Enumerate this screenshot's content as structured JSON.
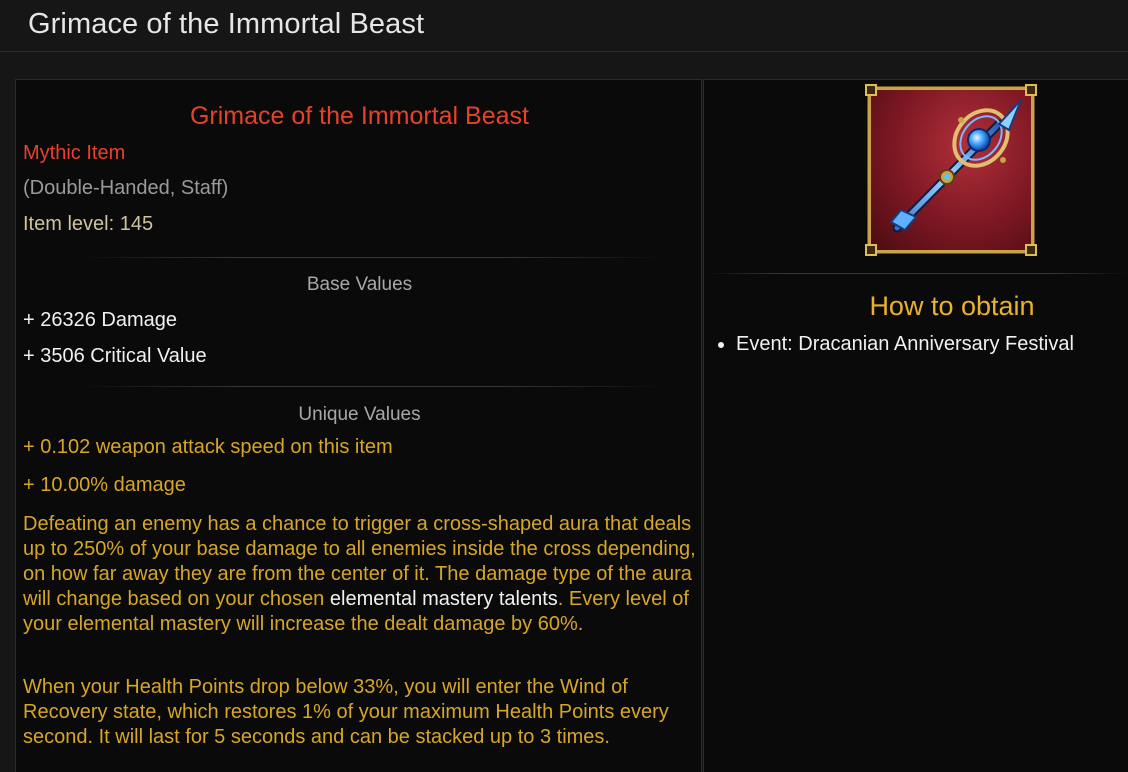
{
  "page": {
    "title": "Grimace of the Immortal Beast"
  },
  "item": {
    "name": "Grimace of the Immortal Beast",
    "rarity": "Mythic Item",
    "type": "(Double-Handed, Staff)",
    "level": "Item level: 145",
    "base_values": {
      "heading": "Base Values",
      "stats": [
        "+ 26326 Damage",
        "+ 3506 Critical Value"
      ]
    },
    "unique_values": {
      "heading": "Unique Values",
      "stats": [
        "+ 0.102 weapon attack speed on this item",
        "+ 10.00% damage"
      ]
    },
    "description_1": {
      "before": "Defeating an enemy has a chance to trigger a cross-shaped aura that deals up to 250% of your base damage to all enemies inside the cross depending, on how far away they are from the center of it. The damage type of the aura will change based on your chosen ",
      "highlight": "elemental mastery talents",
      "after": ". Every level of your elemental mastery will increase the dealt damage by 60%."
    },
    "description_2": "When your Health Points drop below 33%, you will enter the Wind of Recovery state, which restores 1% of your maximum Health Points every second. It will last for 5 seconds and can be stacked up to 3 times.",
    "icon": "staff-icon"
  },
  "obtain": {
    "heading": "How to obtain",
    "sources": [
      "Event: Dracanian Anniversary Festival"
    ]
  },
  "colors": {
    "mythic": "#e8412a",
    "unique": "#d7a628",
    "obtain_heading": "#e8b22c",
    "background": "#0a0a0a"
  }
}
